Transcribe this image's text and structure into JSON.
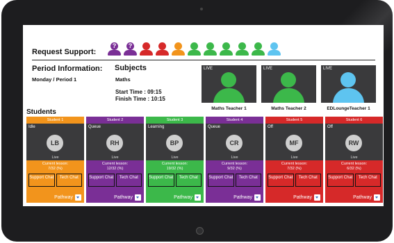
{
  "header": {
    "request_support_label": "Request Support:"
  },
  "support_icons": [
    {
      "name": "question-user-icon",
      "color": "#7a2f96",
      "question": "?"
    },
    {
      "name": "question-user-icon",
      "color": "#7a2f96",
      "question": "?"
    },
    {
      "name": "user-icon",
      "color": "#d62929",
      "question": ""
    },
    {
      "name": "user-icon",
      "color": "#d62929",
      "question": ""
    },
    {
      "name": "user-icon",
      "color": "#f2941c",
      "question": ""
    },
    {
      "name": "user-icon",
      "color": "#3cb84a",
      "question": ""
    },
    {
      "name": "user-icon",
      "color": "#3cb84a",
      "question": ""
    },
    {
      "name": "user-icon",
      "color": "#3cb84a",
      "question": ""
    },
    {
      "name": "user-icon",
      "color": "#3cb84a",
      "question": ""
    },
    {
      "name": "user-icon",
      "color": "#3cb84a",
      "question": ""
    },
    {
      "name": "user-icon",
      "color": "#5ec4f0",
      "question": ""
    }
  ],
  "period": {
    "title": "Period Information:",
    "value": "Monday / Period 1"
  },
  "subjects": {
    "title": "Subjects",
    "value": "Maths",
    "start_time": "Start Time : 09:15",
    "finish_time": "Finish Time : 10:15"
  },
  "teachers": [
    {
      "live": "LIVE",
      "name": "Maths Teacher 1",
      "color": "#3cb84a"
    },
    {
      "live": "LIVE",
      "name": "Maths Teacher 2",
      "color": "#3cb84a"
    },
    {
      "live": "LIVE",
      "name": "EDLoungeTeacher 1",
      "color": "#5ec4f0"
    }
  ],
  "students_label": "Students",
  "students": [
    {
      "label": "Student 1",
      "status": "Idle",
      "initials": "LB",
      "live": "Live",
      "lesson_label": "Current lesson:",
      "lesson_value": "7/32 (%)",
      "support": "Support Chat",
      "tech": "Tech Chat",
      "pathway": "Pathway",
      "color": "#f2941c"
    },
    {
      "label": "Student 2",
      "status": "Queue",
      "initials": "RH",
      "live": "Live",
      "lesson_label": "Current lesson:",
      "lesson_value": "12/32 (%)",
      "support": "Support Chat",
      "tech": "Tech Chat",
      "pathway": "Pathway",
      "color": "#7a2f96"
    },
    {
      "label": "Student 3",
      "status": "Learning",
      "initials": "BP",
      "live": "Live",
      "lesson_label": "Current lesson:",
      "lesson_value": "19/32 (%)",
      "support": "Support Chat",
      "tech": "Tech Chat",
      "pathway": "Pathway",
      "color": "#3cb84a"
    },
    {
      "label": "Student 4",
      "status": "Queue",
      "initials": "CR",
      "live": "Live",
      "lesson_label": "Current lesson:",
      "lesson_value": "9/32 (%)",
      "support": "Support Chat",
      "tech": "Tech Chat",
      "pathway": "Pathway",
      "color": "#7a2f96"
    },
    {
      "label": "Student 5",
      "status": "Off",
      "initials": "MF",
      "live": "Live",
      "lesson_label": "Current lesson:",
      "lesson_value": "7/32 (%)",
      "support": "Support Chat",
      "tech": "Tech Chat",
      "pathway": "Pathway",
      "color": "#d62929"
    },
    {
      "label": "Student 6",
      "status": "Off",
      "initials": "RW",
      "live": "Live",
      "lesson_label": "Current lesson:",
      "lesson_value": "6/32 (%)",
      "support": "Support Chat",
      "tech": "Tech Chat",
      "pathway": "Pathway",
      "color": "#d62929"
    }
  ]
}
